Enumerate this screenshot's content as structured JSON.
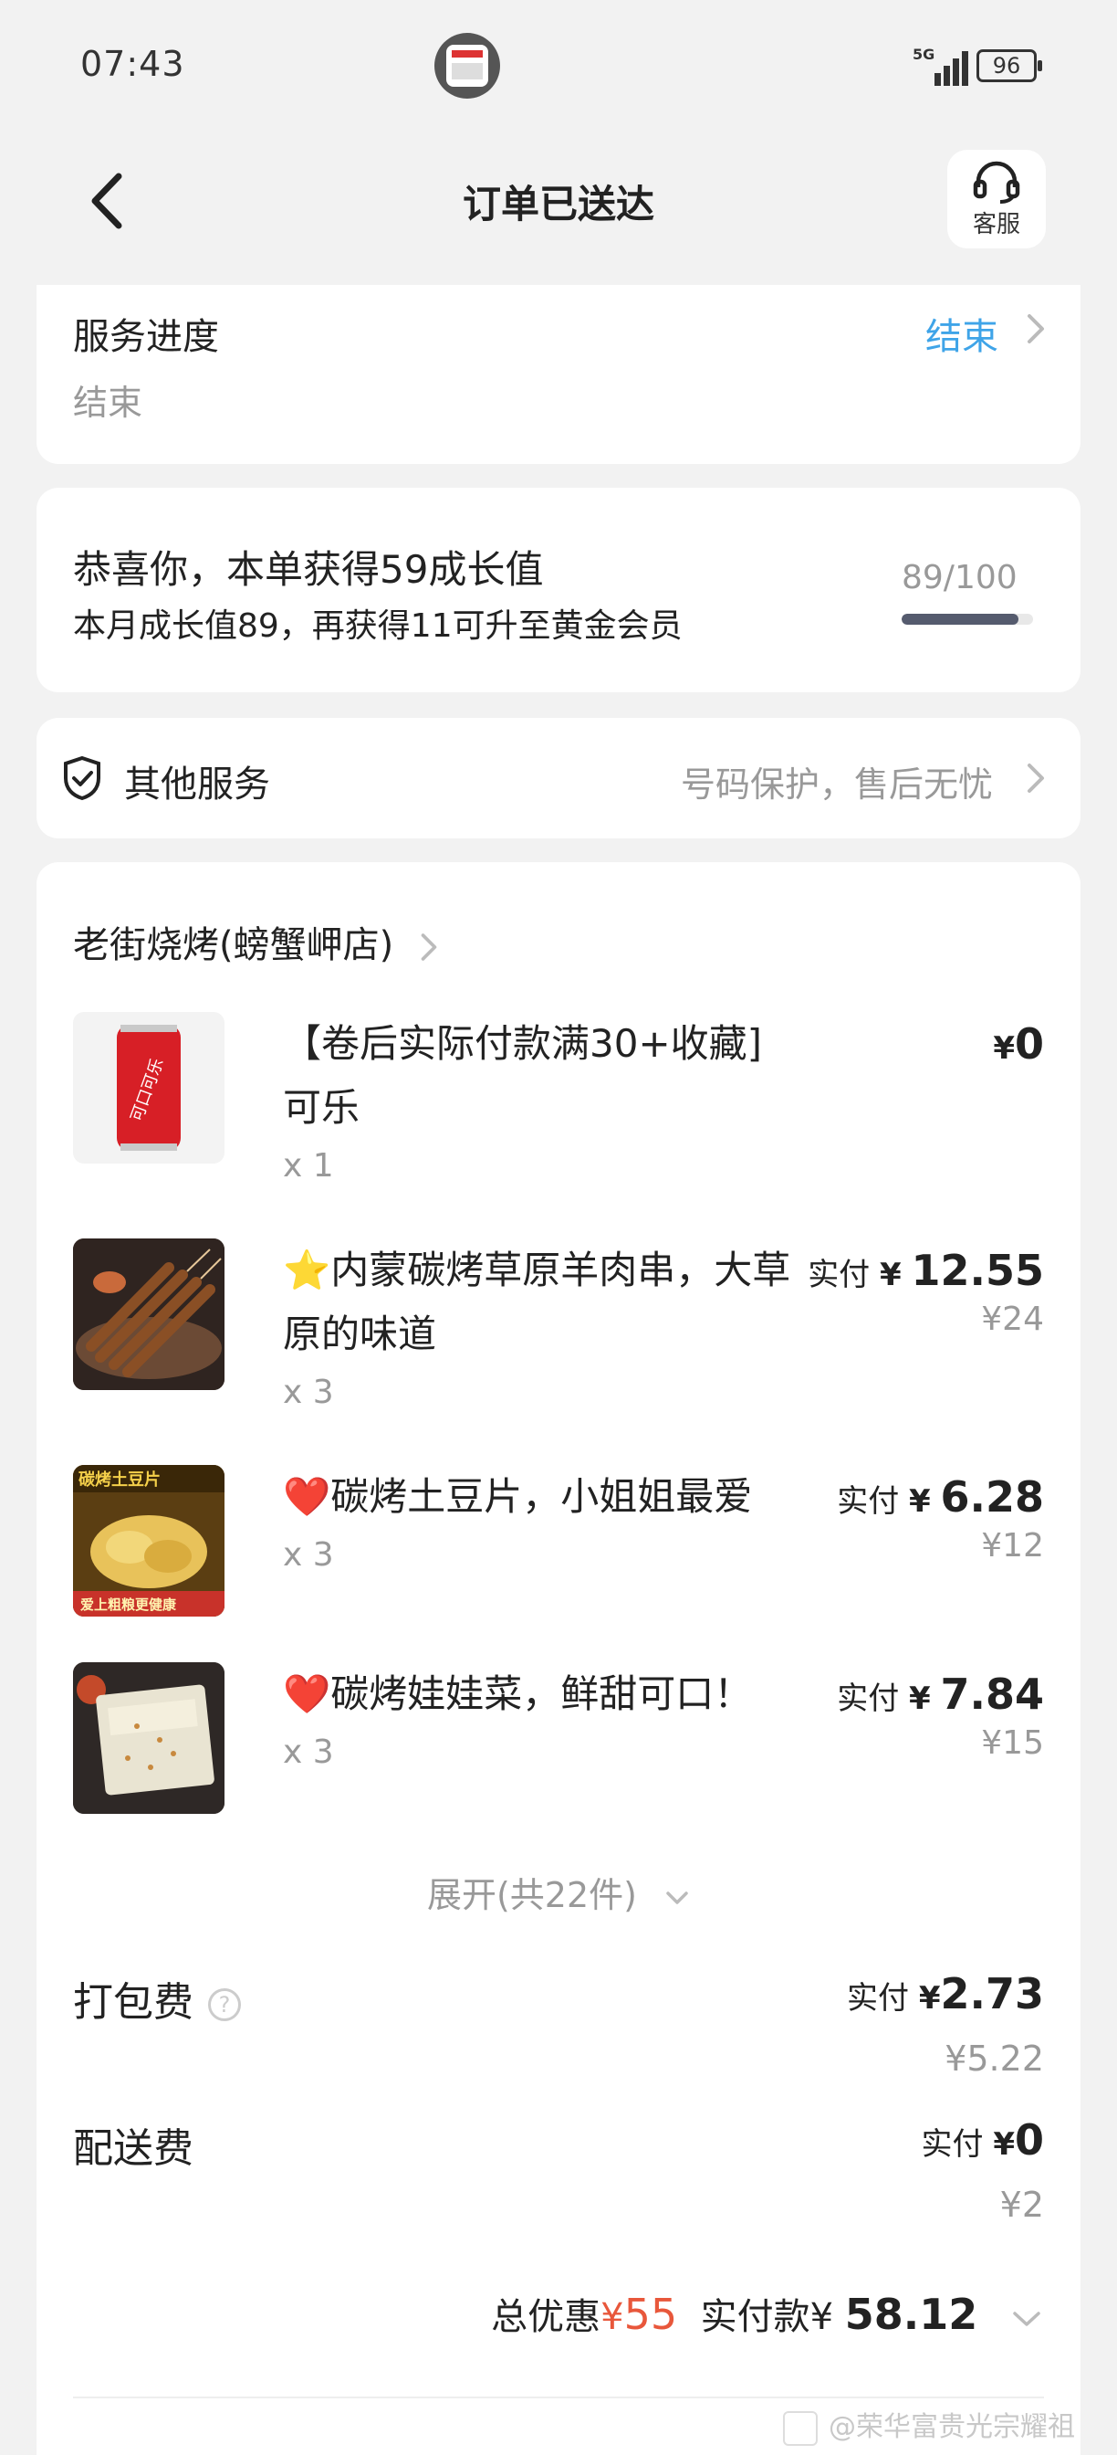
{
  "status_bar": {
    "time": "07:43",
    "network": "5G",
    "battery": "96"
  },
  "header": {
    "title": "订单已送达",
    "service_label": "客服"
  },
  "service_progress": {
    "label": "服务进度",
    "status": "结束",
    "link": "结束"
  },
  "growth": {
    "headline": "恭喜你，本单获得59成长值",
    "detail": "本月成长值89，再获得11可升至黄金会员",
    "score": "89/100",
    "progress": 0.89
  },
  "other_services": {
    "label": "其他服务",
    "detail": "号码保护，售后无忧"
  },
  "order": {
    "store": "老街烧烤(螃蟹岬店)",
    "items": [
      {
        "name": "【卷后实际付款满30+收藏]可乐",
        "qty": "x 1",
        "paid_prefix": "",
        "currency": "¥",
        "price": "0",
        "original": ""
      },
      {
        "name": "⭐内蒙碳烤草原羊肉串，大草原的味道",
        "qty": "x 3",
        "paid_prefix": "实付",
        "currency": "¥",
        "price": "12.55",
        "original": "¥24"
      },
      {
        "name": "❤️碳烤土豆片，小姐姐最爱",
        "qty": "x 3",
        "paid_prefix": "实付",
        "currency": "¥",
        "price": "6.28",
        "original": "¥12"
      },
      {
        "name": "❤️碳烤娃娃菜，鲜甜可口！",
        "qty": "x 3",
        "paid_prefix": "实付",
        "currency": "¥",
        "price": "7.84",
        "original": "¥15"
      }
    ],
    "item_images": [
      "cola",
      "lamb-skewers",
      "potato-chips",
      "baby-cabbage"
    ],
    "image_text": {
      "cola": "可口可乐",
      "potato": "碳烤土豆片",
      "potato_bottom": "爱上粗粮更健康"
    },
    "expand": "展开(共22件)",
    "packing_fee": {
      "label": "打包费",
      "paid_prefix": "实付",
      "currency": "¥",
      "price": "2.73",
      "original": "¥5.22",
      "help_icon": "?"
    },
    "delivery_fee": {
      "label": "配送费",
      "paid_prefix": "实付",
      "currency": "¥",
      "price": "0",
      "original": "¥2"
    },
    "summary": {
      "discount_label": "总优惠",
      "discount_currency": "¥",
      "discount": "55",
      "paid_label": "实付款",
      "currency": "¥",
      "total": "58.12"
    }
  },
  "watermark": "@荣华富贵光宗耀祖",
  "colors": {
    "accent_blue": "#3fa4e8",
    "discount_red": "#e8573b",
    "progress": "#555b6e"
  }
}
